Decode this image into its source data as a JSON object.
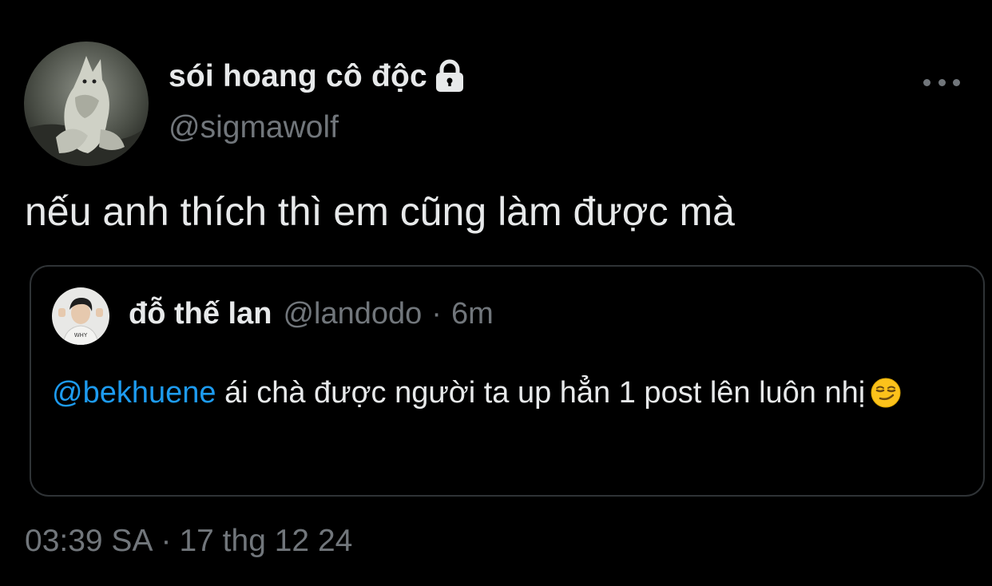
{
  "author": {
    "name": "sói hoang cô độc",
    "handle": "@sigmawolf",
    "protected_icon": "lock-icon",
    "avatar_icon": "wolf-avatar"
  },
  "menu_icon": "more-horizontal-icon",
  "tweet": {
    "text": "nếu anh thích thì em cũng làm được mà"
  },
  "quoted": {
    "name": "đỗ thế lan",
    "handle": "@landodo",
    "separator": "·",
    "time": "6m",
    "mention": "@bekhuene",
    "text": " ái chà được người ta up hẳn 1 post lên luôn nhị",
    "emoji": "smirking-face-emoji",
    "avatar_icon": "person-avatar"
  },
  "timestamp": {
    "time": "03:39 SA",
    "separator": "·",
    "date": "17 thg 12 24"
  },
  "colors": {
    "background": "#000000",
    "primary_text": "#e7e9ea",
    "secondary_text": "#71767b",
    "link": "#1d9bf0",
    "border": "#2f3336"
  }
}
